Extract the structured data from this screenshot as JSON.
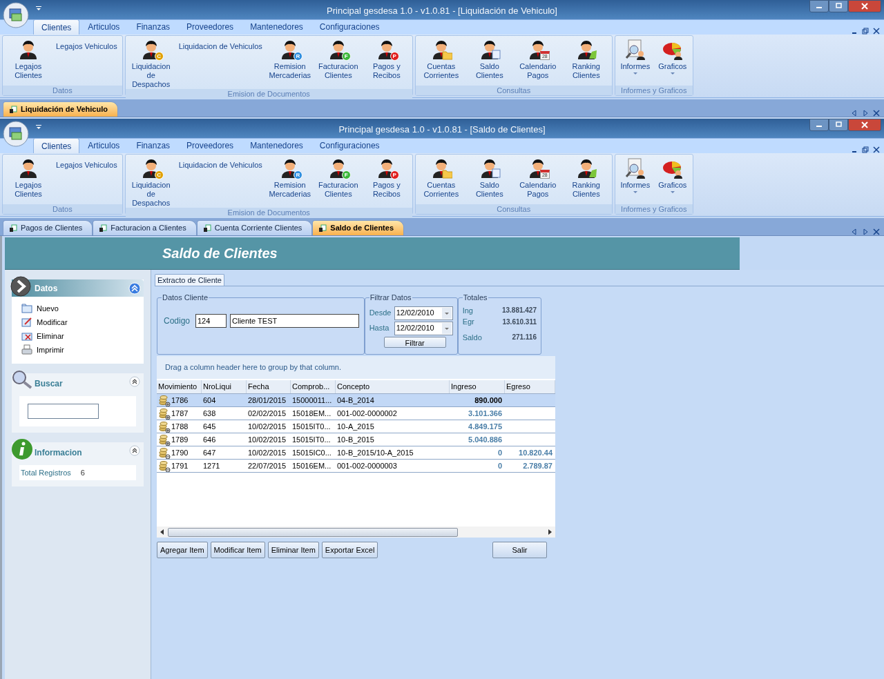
{
  "windows": [
    {
      "title": "Principal gesdesa 1.0 - v1.0.81 - [Liquidación de Vehiculo]",
      "ribbon_tabs": [
        {
          "label": "Clientes",
          "selected": true
        },
        {
          "label": "Articulos",
          "selected": false
        },
        {
          "label": "Finanzas",
          "selected": false
        },
        {
          "label": "Proveedores",
          "selected": false
        },
        {
          "label": "Mantenedores",
          "selected": false
        },
        {
          "label": "Configuraciones",
          "selected": false
        }
      ],
      "ribbon_groups": [
        {
          "label": "Datos",
          "items": [
            {
              "kind": "large",
              "label": "Legajos Clientes"
            },
            {
              "kind": "small",
              "label": "Legajos Vehiculos"
            }
          ]
        },
        {
          "label": "Emision de Documentos",
          "items": [
            {
              "kind": "large",
              "label": "Liquidacion de Despachos",
              "badge": {
                "text": "C",
                "color": "#e0a000"
              }
            },
            {
              "kind": "small",
              "label": "Liquidacion de Vehiculos"
            },
            {
              "kind": "large",
              "label": "Remision Mercaderias",
              "badge": {
                "text": "R",
                "color": "#2f8fe0"
              }
            },
            {
              "kind": "large",
              "label": "Facturacion Clientes",
              "badge": {
                "text": "F",
                "color": "#3cb83c"
              }
            },
            {
              "kind": "large",
              "label": "Pagos y Recibos",
              "badge": {
                "text": "P",
                "color": "#e02020"
              }
            }
          ]
        },
        {
          "label": "Consultas",
          "items": [
            {
              "kind": "large",
              "label": "Cuentas Corrientes"
            },
            {
              "kind": "large",
              "label": "Saldo Clientes"
            },
            {
              "kind": "large",
              "label": "Calendario Pagos",
              "badge": {
                "text": "28"
              }
            },
            {
              "kind": "large",
              "label": "Ranking Clientes"
            }
          ]
        },
        {
          "label": "Informes y Graficos",
          "items": [
            {
              "kind": "dropdown",
              "label": "Informes"
            },
            {
              "kind": "dropdown",
              "label": "Graficos"
            }
          ]
        }
      ],
      "doc_tabs": [
        {
          "label": "Liquidación de Vehiculo",
          "selected": true
        }
      ]
    },
    {
      "title": "Principal gesdesa 1.0 - v1.0.81 - [Saldo de Clientes]",
      "ribbon_tabs": [
        {
          "label": "Clientes",
          "selected": true
        },
        {
          "label": "Articulos",
          "selected": false
        },
        {
          "label": "Finanzas",
          "selected": false
        },
        {
          "label": "Proveedores",
          "selected": false
        },
        {
          "label": "Mantenedores",
          "selected": false
        },
        {
          "label": "Configuraciones",
          "selected": false
        }
      ],
      "ribbon_groups": [
        {
          "label": "Datos",
          "items": [
            {
              "kind": "large",
              "label": "Legajos Clientes"
            },
            {
              "kind": "small",
              "label": "Legajos Vehiculos"
            }
          ]
        },
        {
          "label": "Emision de Documentos",
          "items": [
            {
              "kind": "large",
              "label": "Liquidacion de Despachos",
              "badge": {
                "text": "C",
                "color": "#e0a000"
              }
            },
            {
              "kind": "small",
              "label": "Liquidacion de Vehiculos"
            },
            {
              "kind": "large",
              "label": "Remision Mercaderias",
              "badge": {
                "text": "R",
                "color": "#2f8fe0"
              }
            },
            {
              "kind": "large",
              "label": "Facturacion Clientes",
              "badge": {
                "text": "F",
                "color": "#3cb83c"
              }
            },
            {
              "kind": "large",
              "label": "Pagos y Recibos",
              "badge": {
                "text": "P",
                "color": "#e02020"
              }
            }
          ]
        },
        {
          "label": "Consultas",
          "items": [
            {
              "kind": "large",
              "label": "Cuentas Corrientes"
            },
            {
              "kind": "large",
              "label": "Saldo Clientes"
            },
            {
              "kind": "large",
              "label": "Calendario Pagos",
              "badge": {
                "text": "28"
              }
            },
            {
              "kind": "large",
              "label": "Ranking Clientes"
            }
          ]
        },
        {
          "label": "Informes y Graficos",
          "items": [
            {
              "kind": "dropdown",
              "label": "Informes"
            },
            {
              "kind": "dropdown",
              "label": "Graficos"
            }
          ]
        }
      ],
      "doc_tabs": [
        {
          "label": "Pagos de Clientes",
          "selected": false
        },
        {
          "label": "Facturacion a Clientes",
          "selected": false
        },
        {
          "label": "Cuenta Corriente Clientes",
          "selected": false
        },
        {
          "label": "Saldo de Clientes",
          "selected": true
        }
      ]
    }
  ],
  "form": {
    "header": "Saldo de Clientes",
    "sidebar": {
      "datos": {
        "title": "Datos",
        "items": [
          {
            "label": "Nuevo",
            "kind": "folder"
          },
          {
            "label": "Modificar",
            "kind": "edit"
          },
          {
            "label": "Eliminar",
            "kind": "delete"
          },
          {
            "label": "Imprimir",
            "kind": "print"
          }
        ]
      },
      "buscar": {
        "title": "Buscar"
      },
      "informacion": {
        "title": "Informacion",
        "label": "Total Registros",
        "value": "6"
      }
    },
    "tab": "Extracto de Cliente",
    "datos_cliente": {
      "title": "Datos Cliente",
      "label": "Codigo",
      "code": "124",
      "name": "Cliente TEST"
    },
    "filtrar": {
      "title": "Filtrar Datos",
      "desde_label": "Desde",
      "desde": "12/02/2010",
      "hasta_label": "Hasta",
      "hasta": "12/02/2010",
      "button": "Filtrar"
    },
    "totales": {
      "title": "Totales",
      "rows": [
        {
          "label": "Ing",
          "value": "13.881.427"
        },
        {
          "label": "Egr",
          "value": "13.610.311"
        },
        {
          "label": "Saldo",
          "value": "271.116"
        }
      ]
    },
    "group_hint": "Drag a column header here to group by that column.",
    "columns": [
      "Movimiento",
      "NroLiqui",
      "Fecha",
      "Comprob...",
      "Concepto",
      "Ingreso",
      "Egreso"
    ],
    "rows": [
      {
        "kind": "ingreso",
        "selected": true,
        "cells": [
          "1786",
          "604",
          "28/01/2015",
          "15000011...",
          "04-B_2014",
          "890.000",
          ""
        ]
      },
      {
        "kind": "ingreso",
        "selected": false,
        "cells": [
          "1787",
          "638",
          "02/02/2015",
          "15018EM...",
          "001-002-0000002",
          "3.101.366",
          ""
        ]
      },
      {
        "kind": "ingreso",
        "selected": false,
        "cells": [
          "1788",
          "645",
          "10/02/2015",
          "15015IT0...",
          "10-A_2015",
          "4.849.175",
          ""
        ]
      },
      {
        "kind": "ingreso",
        "selected": false,
        "cells": [
          "1789",
          "646",
          "10/02/2015",
          "15015IT0...",
          "10-B_2015",
          "5.040.886",
          ""
        ]
      },
      {
        "kind": "egreso",
        "selected": false,
        "cells": [
          "1790",
          "647",
          "10/02/2015",
          "15015IC0...",
          "10-B_2015/10-A_2015",
          "0",
          "10.820.44"
        ]
      },
      {
        "kind": "egreso",
        "selected": false,
        "cells": [
          "1791",
          "1271",
          "22/07/2015",
          "15016EM...",
          "001-002-0000003",
          "0",
          "2.789.87"
        ]
      }
    ],
    "buttons": [
      "Agregar Item",
      "Modificar Item",
      "Eliminar Item",
      "Exportar Excel"
    ],
    "exit_button": "Salir"
  }
}
